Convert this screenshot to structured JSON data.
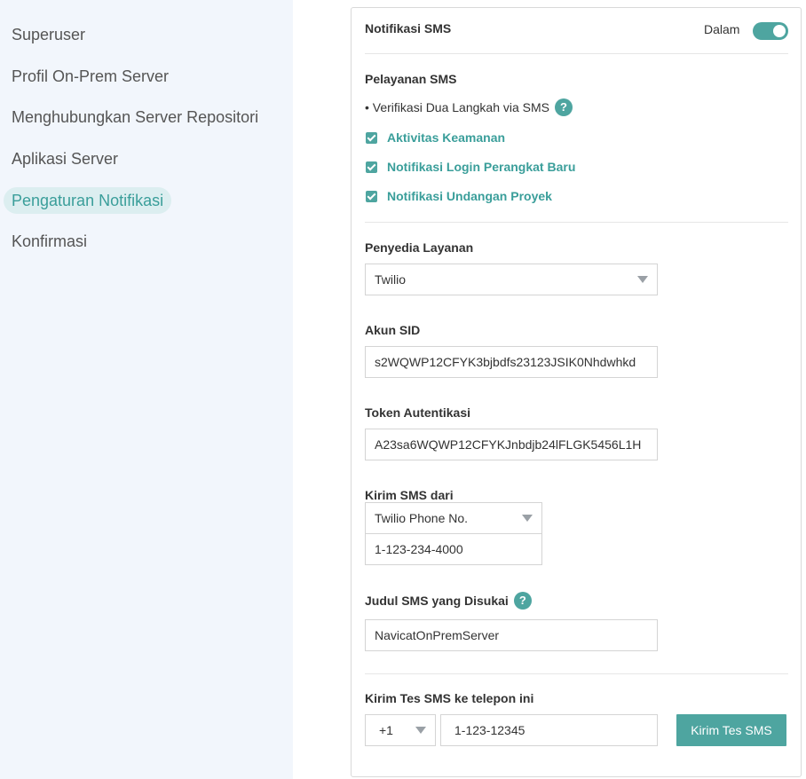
{
  "sidebar": {
    "items": [
      {
        "label": "Superuser",
        "active": false
      },
      {
        "label": "Profil On-Prem Server",
        "active": false
      },
      {
        "label": "Menghubungkan Server Repositori",
        "active": false
      },
      {
        "label": "Aplikasi Server",
        "active": false
      },
      {
        "label": "Pengaturan Notifikasi",
        "active": true
      },
      {
        "label": "Konfirmasi",
        "active": false
      }
    ]
  },
  "panel": {
    "title": "Notifikasi SMS",
    "toggle_label": "Dalam",
    "toggle_on": true,
    "sms_service": {
      "title": "Pelayanan SMS",
      "bullet": "• Verifikasi Dua Langkah via SMS",
      "help": "?",
      "checks": [
        {
          "label": "Aktivitas Keamanan",
          "checked": true
        },
        {
          "label": "Notifikasi Login Perangkat Baru",
          "checked": true
        },
        {
          "label": "Notifikasi Undangan Proyek",
          "checked": true
        }
      ]
    },
    "provider": {
      "label": "Penyedia Layanan",
      "value": "Twilio"
    },
    "account_sid": {
      "label": "Akun SID",
      "value": "s2WQWP12CFYK3bjbdfs23123JSIK0Nhdwhkd"
    },
    "auth_token": {
      "label": "Token Autentikasi",
      "value": "A23sa6WQWP12CFYKJnbdjb24lFLGK5456L1H"
    },
    "send_from": {
      "label": "Kirim SMS dari",
      "type_value": "Twilio Phone No.",
      "number": "1-123-234-4000"
    },
    "preferred_title": {
      "label": "Judul SMS yang Disukai",
      "help": "?",
      "value": "NavicatOnPremServer"
    },
    "test_sms": {
      "label": "Kirim Tes SMS ke telepon ini",
      "country_code": "+1",
      "phone": "1-123-12345",
      "button": "Kirim Tes SMS"
    }
  },
  "colors": {
    "accent": "#4ea5a0",
    "accent_text": "#3a9e9a",
    "sidebar_bg": "#f2f6fc",
    "active_bg": "#dceef0"
  }
}
